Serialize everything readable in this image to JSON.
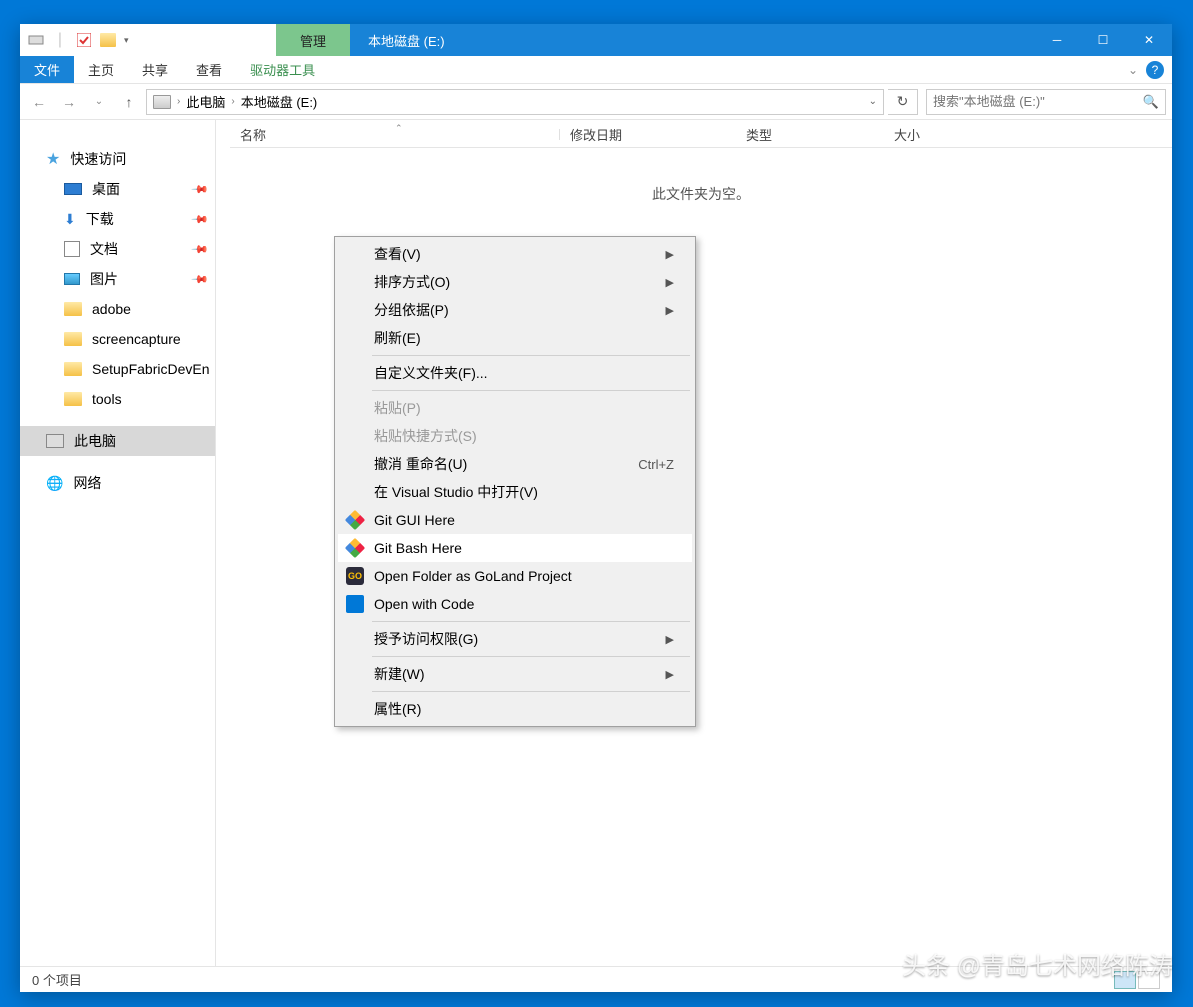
{
  "title_manage": "管理",
  "title_path": "本地磁盘 (E:)",
  "ribbon": {
    "file": "文件",
    "home": "主页",
    "share": "共享",
    "view": "查看",
    "tool": "驱动器工具"
  },
  "breadcrumb": {
    "pc": "此电脑",
    "drive": "本地磁盘 (E:)"
  },
  "search_placeholder": "搜索\"本地磁盘 (E:)\"",
  "columns": {
    "name": "名称",
    "date": "修改日期",
    "type": "类型",
    "size": "大小"
  },
  "empty": "此文件夹为空。",
  "sidebar": {
    "quick": "快速访问",
    "desktop": "桌面",
    "downloads": "下载",
    "documents": "文档",
    "pictures": "图片",
    "adobe": "adobe",
    "screencapture": "screencapture",
    "setupfabric": "SetupFabricDevEn",
    "tools": "tools",
    "thispc": "此电脑",
    "network": "网络"
  },
  "ctx": {
    "view": "查看(V)",
    "sort": "排序方式(O)",
    "group": "分组依据(P)",
    "refresh": "刷新(E)",
    "customize": "自定义文件夹(F)...",
    "paste": "粘贴(P)",
    "paste_shortcut": "粘贴快捷方式(S)",
    "undo": "撤消 重命名(U)",
    "undo_key": "Ctrl+Z",
    "vs": "在 Visual Studio 中打开(V)",
    "git_gui": "Git GUI Here",
    "git_bash": "Git Bash Here",
    "goland": "Open Folder as GoLand Project",
    "vscode": "Open with Code",
    "grant": "授予访问权限(G)",
    "new": "新建(W)",
    "props": "属性(R)"
  },
  "status": "0 个项目",
  "watermark": "头条 @青岛七术网络陈涛"
}
